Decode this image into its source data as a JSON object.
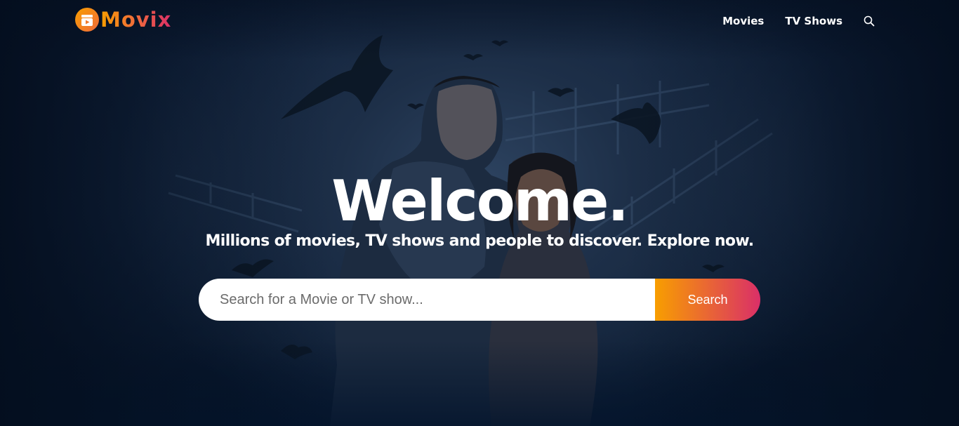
{
  "app": {
    "logo_text": "Movix",
    "logo_icon": "film-clapper-play-icon",
    "brand_gradient": [
      "#f89e00",
      "#da2f68"
    ]
  },
  "nav": {
    "items": [
      {
        "label": "Movies"
      },
      {
        "label": "TV Shows"
      }
    ],
    "search_icon": "search-icon"
  },
  "hero": {
    "title": "Welcome.",
    "subtitle": "Millions of movies, TV shows and people to discover. Explore now.",
    "search": {
      "placeholder": "Search for a Movie or TV show...",
      "value": "",
      "button_label": "Search"
    },
    "background_color": "#04152d"
  }
}
